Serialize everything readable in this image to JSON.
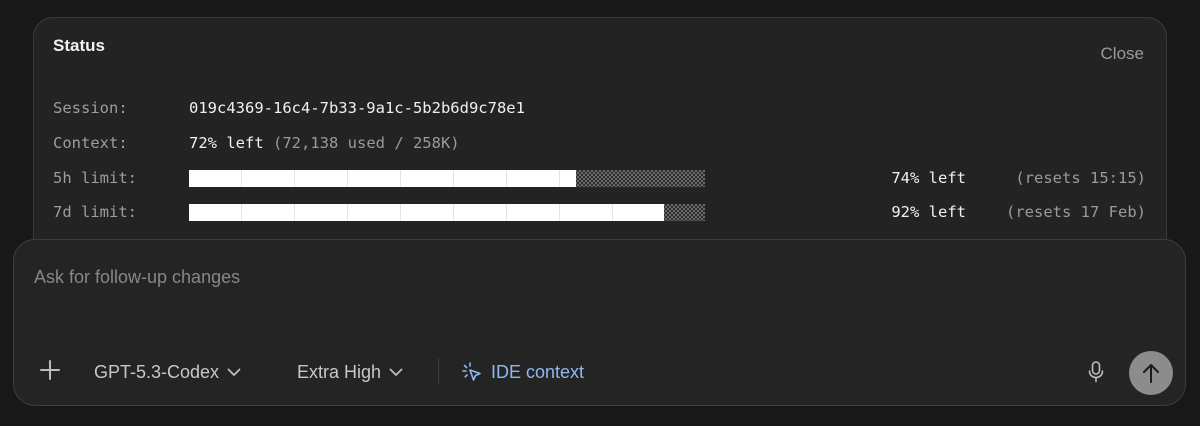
{
  "status": {
    "title": "Status",
    "close_label": "Close",
    "session": {
      "label": "Session:",
      "value": "019c4369-16c4-7b33-9a1c-5b2b6d9c78e1"
    },
    "context": {
      "label": "Context:",
      "value": "72% left",
      "detail": "(72,138 used / 258K)"
    },
    "limits": [
      {
        "label": "5h limit:",
        "fraction_used": 0.75,
        "pct_left": "74% left",
        "resets": "(resets 15:15)"
      },
      {
        "label": "7d limit:",
        "fraction_used": 0.92,
        "pct_left": "92% left",
        "resets": "(resets 17 Feb)"
      }
    ]
  },
  "composer": {
    "placeholder": "Ask for follow-up changes",
    "model_label": "GPT-5.3-Codex",
    "effort_label": "Extra High",
    "ide_context_label": "IDE context",
    "icons": {
      "add": "plus-icon",
      "model_dropdown": "chevron-down-icon",
      "effort_dropdown": "chevron-down-icon",
      "ide": "cursor-click-icon",
      "mic": "microphone-icon",
      "send": "arrow-up-icon"
    },
    "accent_color": "#8fb8f0"
  }
}
